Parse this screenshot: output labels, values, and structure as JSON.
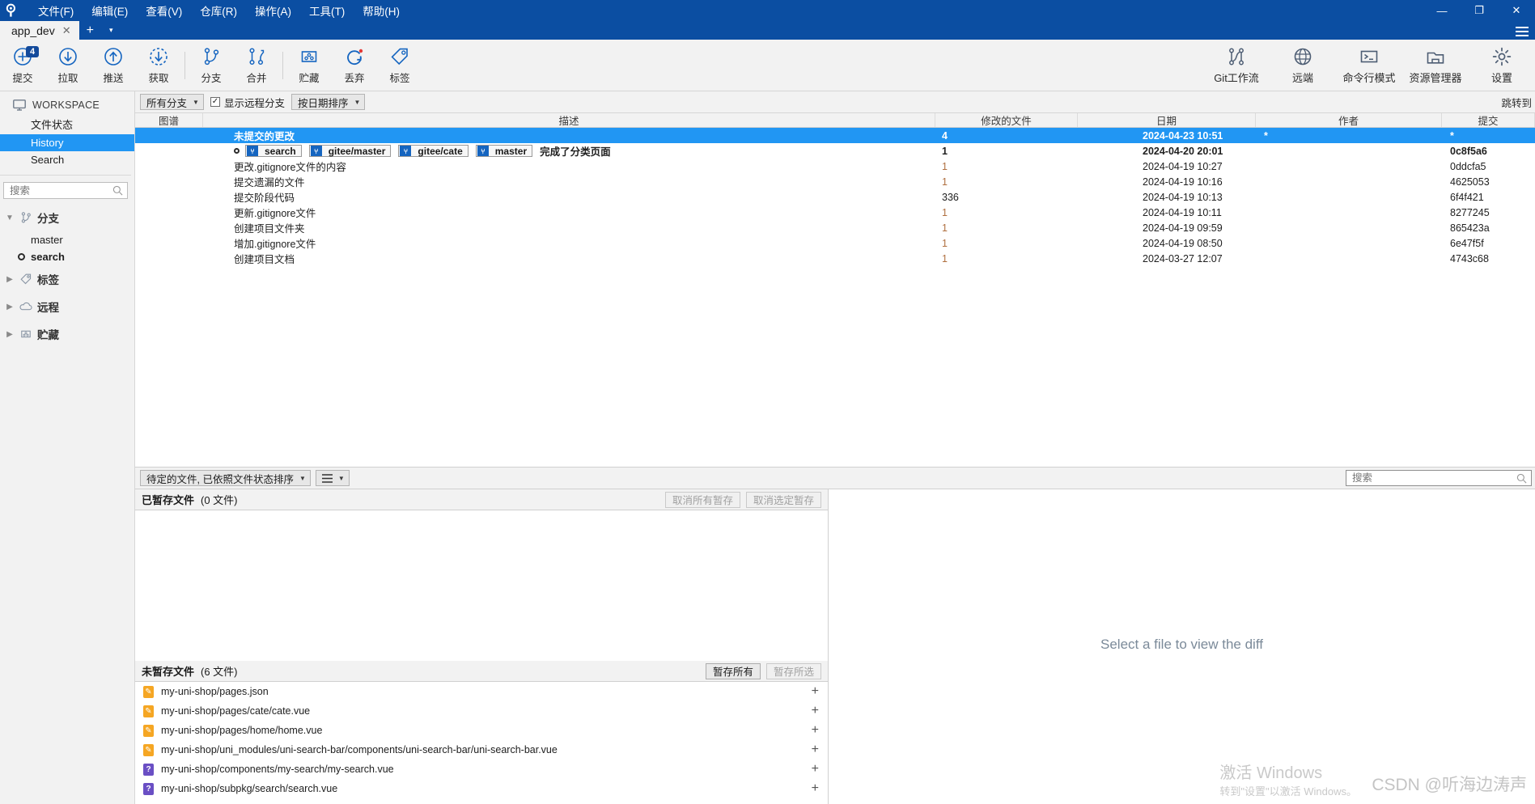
{
  "window": {
    "logo": "key-icon",
    "minimize": "—",
    "maximize": "❐",
    "close": "✕"
  },
  "menubar": {
    "items": [
      {
        "label": "文件(F)",
        "name": "menu-file"
      },
      {
        "label": "编辑(E)",
        "name": "menu-edit"
      },
      {
        "label": "查看(V)",
        "name": "menu-view"
      },
      {
        "label": "仓库(R)",
        "name": "menu-repository"
      },
      {
        "label": "操作(A)",
        "name": "menu-actions"
      },
      {
        "label": "工具(T)",
        "name": "menu-tools"
      },
      {
        "label": "帮助(H)",
        "name": "menu-help"
      }
    ]
  },
  "tabs": {
    "active": "app_dev",
    "close_glyph": "✕",
    "new_tab_glyph": "+",
    "dropdown_glyph": "▾"
  },
  "toolbar": {
    "left": [
      {
        "label": "提交",
        "icon": "commit-icon",
        "badge": "4"
      },
      {
        "label": "拉取",
        "icon": "pull-icon",
        "badge": ""
      },
      {
        "label": "推送",
        "icon": "push-icon",
        "badge": ""
      },
      {
        "label": "获取",
        "icon": "fetch-icon",
        "badge": ""
      },
      {
        "label": "分支",
        "icon": "branch-icon",
        "badge": ""
      },
      {
        "label": "合并",
        "icon": "merge-icon",
        "badge": ""
      },
      {
        "label": "贮藏",
        "icon": "stash-icon",
        "badge": ""
      },
      {
        "label": "丢弃",
        "icon": "discard-icon",
        "badge": ""
      },
      {
        "label": "标签",
        "icon": "tag-icon",
        "badge": ""
      }
    ],
    "right": [
      {
        "label": "Git工作流",
        "icon": "gitflow-icon"
      },
      {
        "label": "远端",
        "icon": "globe-icon"
      },
      {
        "label": "命令行模式",
        "icon": "terminal-icon"
      },
      {
        "label": "资源管理器",
        "icon": "explorer-icon"
      },
      {
        "label": "设置",
        "icon": "gear-icon"
      }
    ]
  },
  "sidebar": {
    "workspace_label": "WORKSPACE",
    "nav": [
      {
        "label": "文件状态",
        "active": false
      },
      {
        "label": "History",
        "active": true
      },
      {
        "label": "Search",
        "active": false
      }
    ],
    "search_placeholder": "搜索",
    "search_value": "",
    "groups": [
      {
        "label": "分支",
        "icon": "branch-icon",
        "expanded": true,
        "items": [
          {
            "label": "master",
            "current": false
          },
          {
            "label": "search",
            "current": true
          }
        ]
      },
      {
        "label": "标签",
        "icon": "tag-icon",
        "expanded": false,
        "items": []
      },
      {
        "label": "远程",
        "icon": "cloud-icon",
        "expanded": false,
        "items": []
      },
      {
        "label": "贮藏",
        "icon": "stash-icon",
        "expanded": false,
        "items": []
      }
    ]
  },
  "filterbar": {
    "branch_filter": "所有分支",
    "show_remote_label": "显示远程分支",
    "show_remote_checked": true,
    "sort_label": "按日期排序",
    "jump_to": "跳转到"
  },
  "history": {
    "columns": [
      "图谱",
      "描述",
      "修改的文件",
      "日期",
      "作者",
      "提交"
    ],
    "rows": [
      {
        "selected": true,
        "graph": "ring",
        "description": "未提交的更改",
        "badges": [],
        "files": "4",
        "date": "2024-04-23 10:51",
        "author": "*",
        "hash": "*",
        "bold": true
      },
      {
        "selected": false,
        "graph": "commit",
        "description": "完成了分类页面",
        "badges": [
          "search",
          "gitee/master",
          "gitee/cate",
          "master"
        ],
        "files": "1",
        "date": "2024-04-20 20:01",
        "author": "",
        "hash": "0c8f5a6",
        "bold": true
      },
      {
        "selected": false,
        "graph": "dot",
        "description": "更改.gitignore文件的内容",
        "badges": [],
        "files": "1",
        "date": "2024-04-19 10:27",
        "author": "",
        "hash": "0ddcfa5",
        "bold": false
      },
      {
        "selected": false,
        "graph": "dot",
        "description": "提交遗漏的文件",
        "badges": [],
        "files": "1",
        "date": "2024-04-19 10:16",
        "author": "",
        "hash": "4625053",
        "bold": false
      },
      {
        "selected": false,
        "graph": "dot",
        "description": "提交阶段代码",
        "badges": [],
        "files": "336",
        "date": "2024-04-19 10:13",
        "author": "",
        "hash": "6f4f421",
        "bold": false
      },
      {
        "selected": false,
        "graph": "dot",
        "description": "更新.gitignore文件",
        "badges": [],
        "files": "1",
        "date": "2024-04-19 10:11",
        "author": "",
        "hash": "8277245",
        "bold": false
      },
      {
        "selected": false,
        "graph": "dot",
        "description": "创建项目文件夹",
        "badges": [],
        "files": "1",
        "date": "2024-04-19 09:59",
        "author": "",
        "hash": "865423a",
        "bold": false
      },
      {
        "selected": false,
        "graph": "dot",
        "description": "增加.gitignore文件",
        "badges": [],
        "files": "1",
        "date": "2024-04-19 08:50",
        "author": "",
        "hash": "6e47f5f",
        "bold": false
      },
      {
        "selected": false,
        "graph": "dot",
        "description": "创建项目文档",
        "badges": [],
        "files": "1",
        "date": "2024-03-27 12:07",
        "author": "",
        "hash": "4743c68",
        "bold": false
      }
    ],
    "bottom_bar": {
      "sort_combo": "待定的文件, 已依照文件状态排序",
      "view_combo_icon": "list-icon",
      "search_placeholder": "搜索",
      "search_value": ""
    }
  },
  "staged": {
    "title": "已暂存文件",
    "count": "(0 文件)",
    "unstage_all": "取消所有暂存",
    "unstage_selected": "取消选定暂存",
    "files": []
  },
  "unstaged": {
    "title": "未暂存文件",
    "count": "(6 文件)",
    "stage_all": "暂存所有",
    "stage_selected": "暂存所选",
    "files": [
      {
        "status": "mod",
        "status_glyph": "✎",
        "path": "my-uni-shop/pages.json"
      },
      {
        "status": "mod",
        "status_glyph": "✎",
        "path": "my-uni-shop/pages/cate/cate.vue"
      },
      {
        "status": "mod",
        "status_glyph": "✎",
        "path": "my-uni-shop/pages/home/home.vue"
      },
      {
        "status": "mod",
        "status_glyph": "✎",
        "path": "my-uni-shop/uni_modules/uni-search-bar/components/uni-search-bar/uni-search-bar.vue"
      },
      {
        "status": "new",
        "status_glyph": "?",
        "path": "my-uni-shop/components/my-search/my-search.vue"
      },
      {
        "status": "new",
        "status_glyph": "?",
        "path": "my-uni-shop/subpkg/search/search.vue"
      }
    ]
  },
  "diff": {
    "empty_text": "Select a file to view the diff"
  },
  "watermarks": {
    "activate_line1": "激活 Windows",
    "activate_line2": "转到\"设置\"以激活 Windows。",
    "csdn": "CSDN @听海边涛声"
  },
  "colors": {
    "titlebar": "#0b4ea2",
    "selection": "#2196f3",
    "accent": "#1565c0",
    "chrome": "#f2f2f2"
  }
}
